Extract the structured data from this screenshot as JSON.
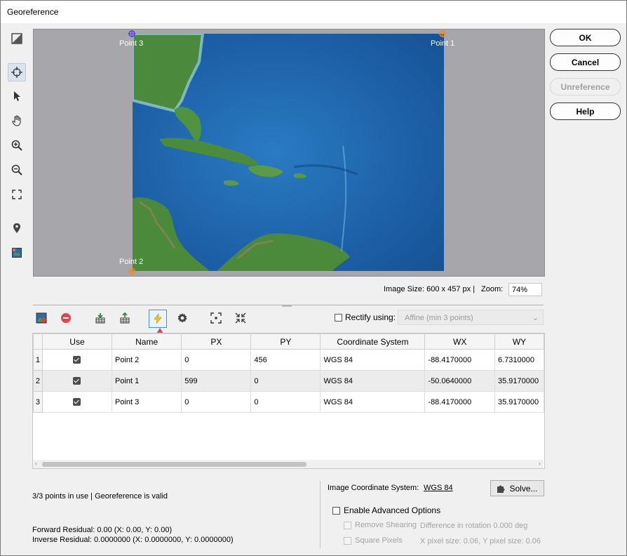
{
  "window": {
    "title": "Georeference"
  },
  "left_toolbar": {
    "icons": [
      "split-view-icon",
      "crosshair-icon",
      "pointer-icon",
      "hand-icon",
      "zoom-in-icon",
      "zoom-out-icon",
      "fit-extent-icon",
      "location-pin-icon",
      "image-icon"
    ],
    "active": "crosshair-icon"
  },
  "map": {
    "points": [
      {
        "label": "Point 3",
        "color": "#5a3ee0"
      },
      {
        "label": "Point 1",
        "color": "#f08a1c"
      },
      {
        "label": "Point 2",
        "color": "#f08a1c"
      }
    ]
  },
  "buttons": {
    "ok": "OK",
    "cancel": "Cancel",
    "unreference": "Unreference",
    "help": "Help"
  },
  "image_info": {
    "size_text": "Image Size: 600 x 457 px  |",
    "zoom_label": "Zoom:",
    "zoom_value": "74%"
  },
  "grid_toolbar": {
    "icons": [
      "add-image-point-icon",
      "remove-point-icon",
      "import-points-icon",
      "export-points-icon",
      "auto-match-icon",
      "settings-icon",
      "focus-point-icon",
      "collapse-icon"
    ],
    "active": "auto-match-icon",
    "rectify_label": "Rectify using:",
    "rectify_checked": false,
    "rectify_option": "Affine (min 3 points)"
  },
  "table": {
    "columns": [
      "Use",
      "Name",
      "PX",
      "PY",
      "Coordinate System",
      "WX",
      "WY"
    ],
    "rows": [
      {
        "index": "1",
        "use": true,
        "name": "Point 2",
        "px": "0",
        "py": "456",
        "cs": "WGS 84",
        "wx": "-88.4170000",
        "wy": "6.7310000"
      },
      {
        "index": "2",
        "use": true,
        "name": "Point 1",
        "px": "599",
        "py": "0",
        "cs": "WGS 84",
        "wx": "-50.0640000",
        "wy": "35.9170000"
      },
      {
        "index": "3",
        "use": true,
        "name": "Point 3",
        "px": "0",
        "py": "0",
        "cs": "WGS 84",
        "wx": "-88.4170000",
        "wy": "35.9170000"
      }
    ]
  },
  "status": {
    "points_text": "3/3 points in use  |  Georeference is valid",
    "forward_residual": "Forward Residual: 0.00 (X: 0.00, Y: 0.00)",
    "inverse_residual": "Inverse Residual: 0.0000000 (X: 0.0000000, Y: 0.0000000)"
  },
  "coordinate_panel": {
    "label": "Image Coordinate System:",
    "link": "WGS 84",
    "solve": "Solve...",
    "advanced_label": "Enable Advanced Options",
    "remove_shearing": "Remove Shearing",
    "rotation_diff": "Difference in rotation 0.000 deg",
    "square_pixels": "Square Pixels",
    "pixel_size": "X pixel size: 0.06, Y pixel size: 0.06"
  },
  "colors": {
    "accent_red": "#e0454e",
    "ocean": "#1f63a8",
    "land": "#4a8a3a"
  }
}
